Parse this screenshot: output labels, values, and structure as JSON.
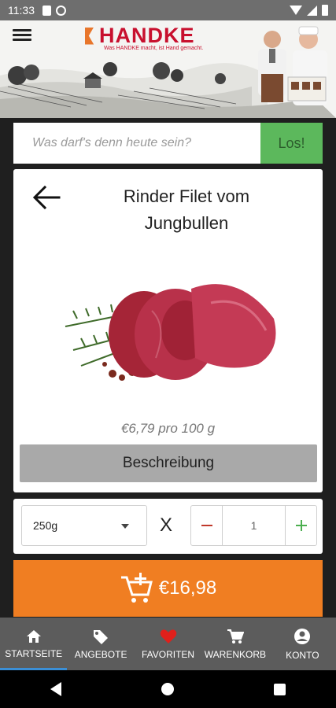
{
  "status_bar": {
    "time": "11:33"
  },
  "header": {
    "logo_text": "HANDKE",
    "tagline": "Was HANDKE macht, ist Hand gemacht."
  },
  "search": {
    "placeholder": "Was darf's denn heute sein?",
    "button_label": "Los!"
  },
  "product": {
    "title": "Rinder Filet vom Jungbullen",
    "price_per_unit": "€6,79 pro 100 g",
    "description_label": "Beschreibung"
  },
  "order": {
    "weight_selected": "250g",
    "times_sign": "X",
    "quantity": "1",
    "total": "€16,98"
  },
  "bottom_nav": [
    {
      "label": "STARTSEITE",
      "icon": "home-icon"
    },
    {
      "label": "ANGEBOTE",
      "icon": "tag-icon"
    },
    {
      "label": "FAVORITEN",
      "icon": "heart-icon"
    },
    {
      "label": "WARENKORB",
      "icon": "cart-icon"
    },
    {
      "label": "KONTO",
      "icon": "account-icon"
    }
  ],
  "colors": {
    "brand_red": "#c8102e",
    "brand_orange": "#f07e22",
    "search_green": "#5cb85c",
    "favorite_red": "#e0201b",
    "nav_bg": "#5c5c5c"
  }
}
